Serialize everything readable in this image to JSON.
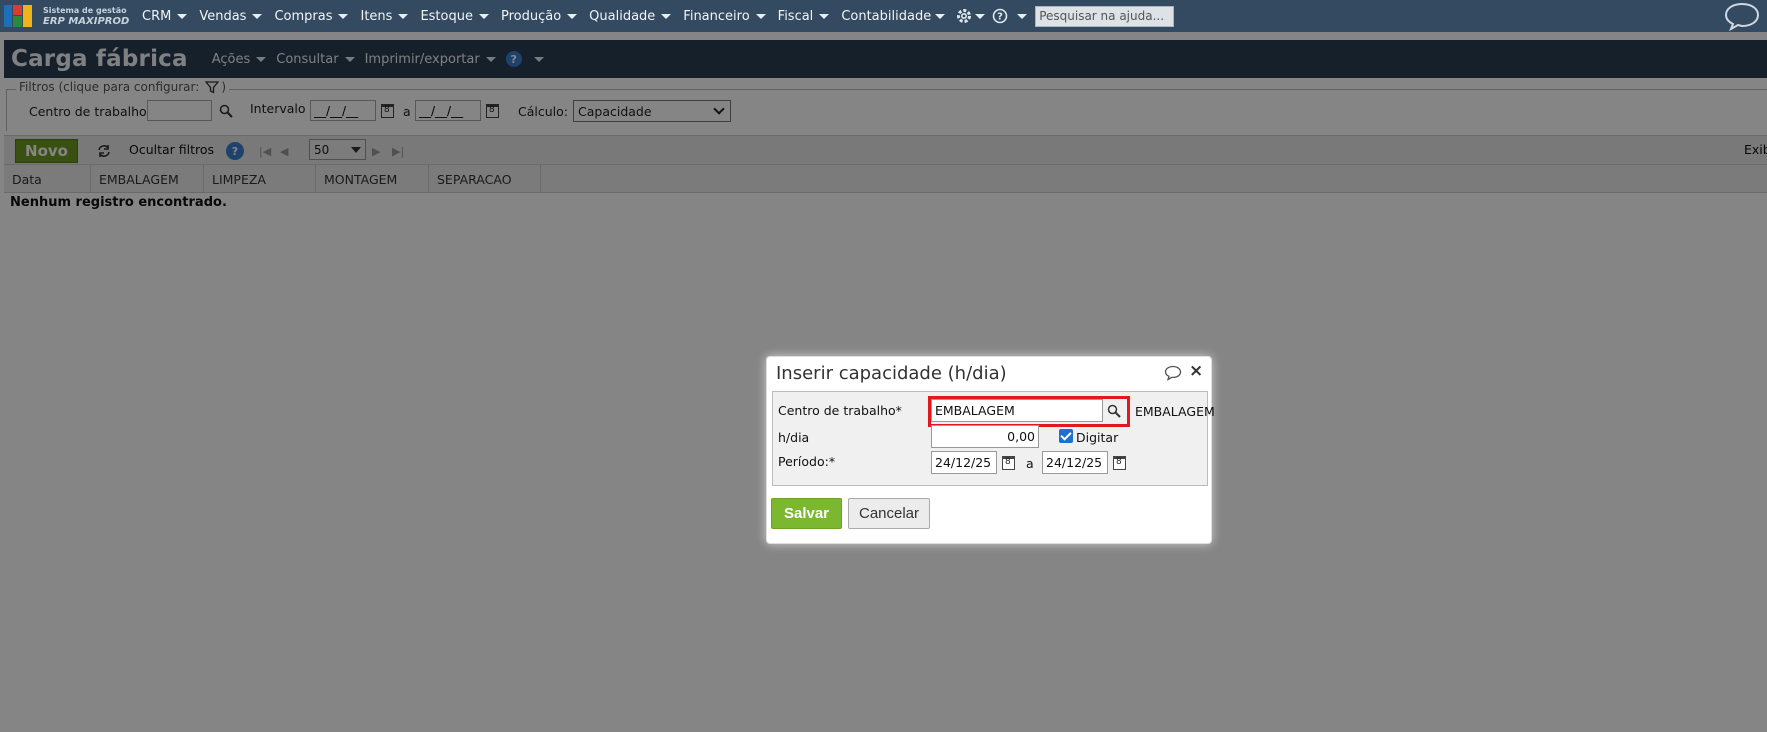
{
  "app": {
    "logo_line1": "Sistema de gestão",
    "logo_line2": "ERP MAXIPROD",
    "menu": [
      "CRM",
      "Vendas",
      "Compras",
      "Itens",
      "Estoque",
      "Produção",
      "Qualidade",
      "Financeiro",
      "Fiscal",
      "Contabilidade"
    ],
    "search_value": "Pesquisar na ajuda..."
  },
  "page": {
    "title": "Carga fábrica",
    "head_menu": [
      "Ações",
      "Consultar",
      "Imprimir/exportar"
    ],
    "help_glyph": "?"
  },
  "filters": {
    "legend": "Filtros (clique para configurar:",
    "legend_end": ")",
    "work_center_label": "Centro de trabalho",
    "work_center_value": "",
    "interval_label": "Intervalo",
    "date_from": "__/__/__",
    "date_sep": "a",
    "date_to": "__/__/__",
    "calc_label": "Cálculo:",
    "calc_value": "Capacidade"
  },
  "toolbar": {
    "new_label": "Novo",
    "hide_filters_label": "Ocultar filtros",
    "page_size": "50",
    "right_text": "Exib"
  },
  "grid": {
    "columns": [
      "Data",
      "EMBALAGEM",
      "LIMPEZA",
      "MONTAGEM",
      "SEPARACAO"
    ],
    "empty_message": "Nenhum registro encontrado."
  },
  "dialog": {
    "title": "Inserir capacidade (h/dia)",
    "close_glyph": "×",
    "work_center_label": "Centro de trabalho*",
    "work_center_value": "EMBALAGEM",
    "work_center_desc": "EMBALAGEM",
    "hours_label": "h/dia",
    "hours_value": "0,00",
    "type_label": "Digitar",
    "period_label": "Período:*",
    "period_from": "24/12/25",
    "period_sep": "a",
    "period_to": "24/12/25",
    "save_label": "Salvar",
    "cancel_label": "Cancelar"
  },
  "colors": {
    "topbar": "#344a60",
    "header": "#2b3e52",
    "primary_button": "#7cb82f",
    "focus_outline": "#e0191e"
  },
  "icons": [
    "logo-icon",
    "gear-icon",
    "help-icon",
    "chat-icon",
    "filter-icon",
    "search-icon",
    "calendar-icon",
    "refresh-icon",
    "close-icon",
    "checkbox-checked-icon"
  ]
}
